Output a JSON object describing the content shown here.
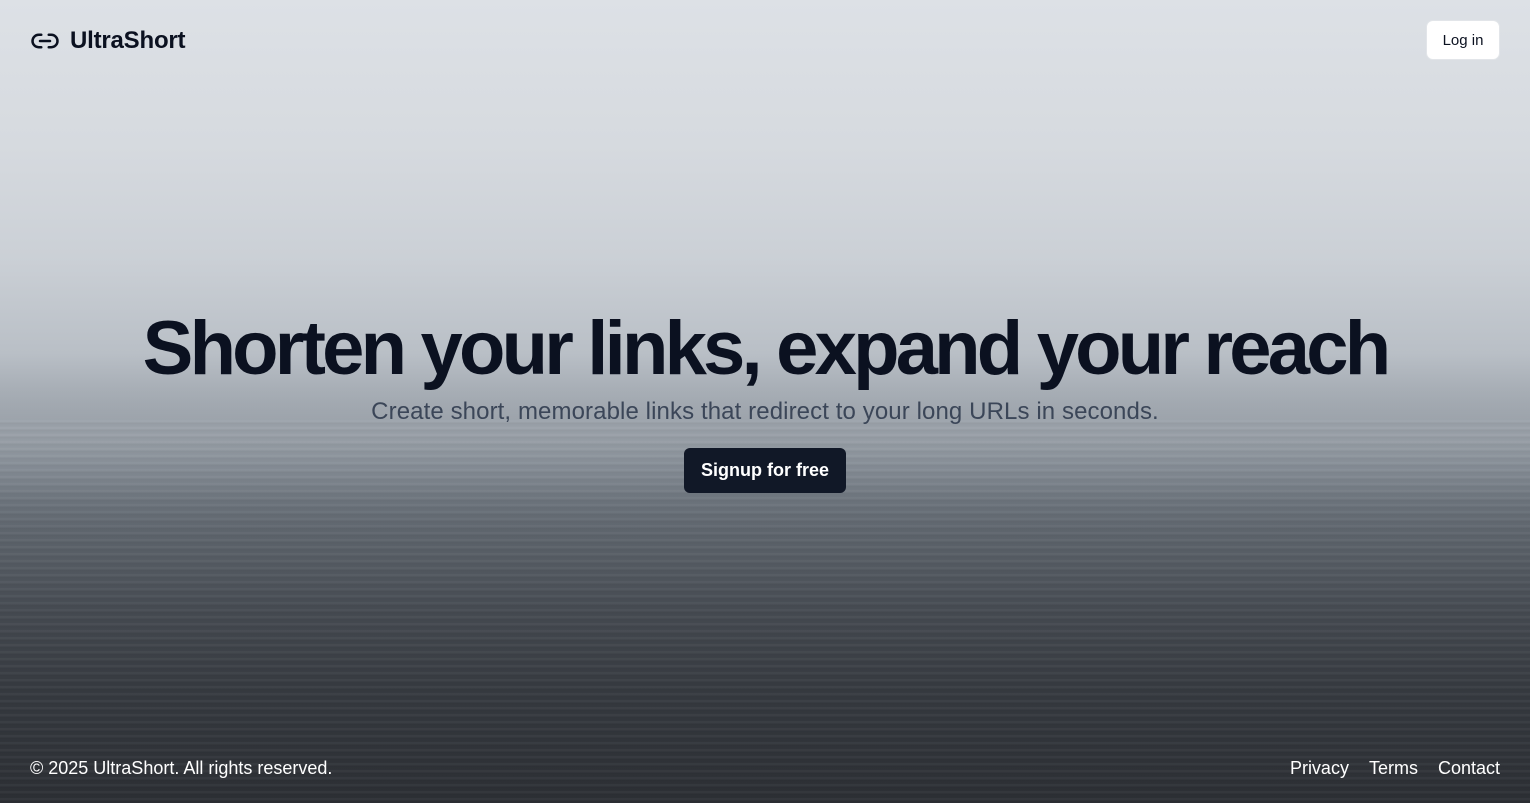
{
  "header": {
    "brand_name": "UltraShort",
    "brand_icon": "link-icon",
    "login_label": "Log in"
  },
  "hero": {
    "title": "Shorten your links, expand your reach",
    "subtitle": "Create short, memorable links that redirect to your long URLs in seconds.",
    "cta_label": "Signup for free"
  },
  "footer": {
    "copyright": "© 2025 UltraShort. All rights reserved.",
    "links": [
      "Privacy",
      "Terms",
      "Contact"
    ]
  },
  "colors": {
    "text_dark": "#0b1120",
    "subtitle": "#3b4658",
    "cta_bg": "#111827",
    "footer_text": "#ffffff"
  }
}
